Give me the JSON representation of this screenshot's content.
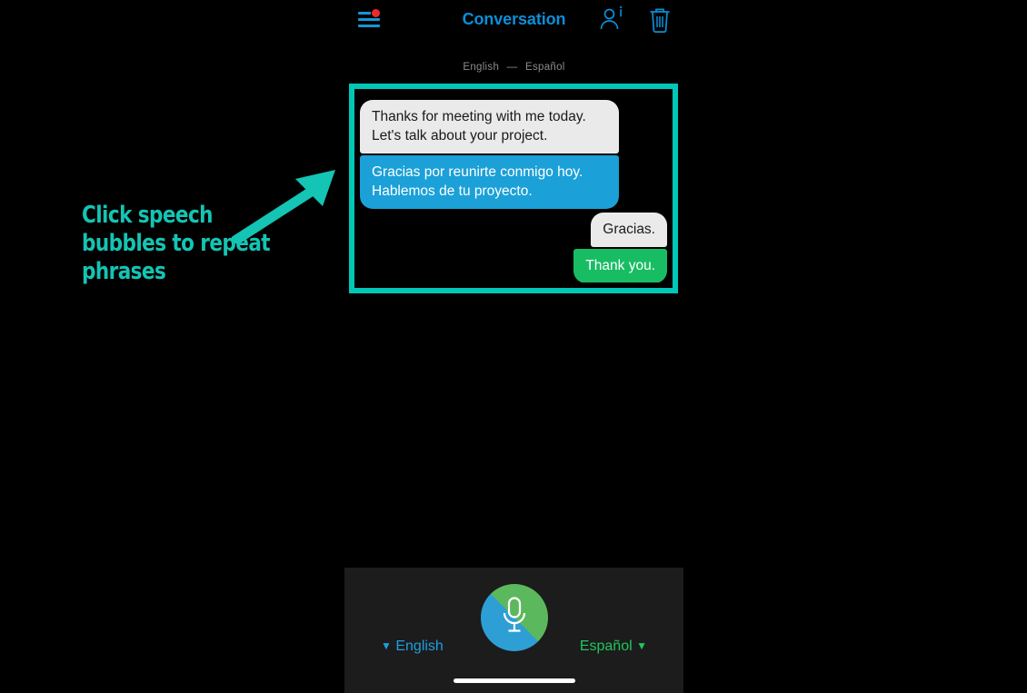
{
  "app": {
    "background_color": "#000000",
    "accent_blue": "#0a8fd8",
    "accent_green": "#18bd63",
    "highlight_teal": "#00c7b7"
  },
  "header": {
    "title": "Conversation",
    "menu_icon": "hamburger-menu-icon",
    "menu_badge": true,
    "person_info_icon": "person-info-icon",
    "trash_icon": "trash-icon"
  },
  "subtitle": {
    "source_language": "English",
    "separator": "—",
    "target_language": "Español"
  },
  "conversation": {
    "messages": [
      {
        "side": "left",
        "source_text": "Thanks for meeting with me today. Let's talk about your project.",
        "translated_text": "Gracias por reunirte conmigo hoy. Hablemos de tu proyecto.",
        "source_bubble_color": "#eaeaea",
        "translated_bubble_color": "#1ba0d8"
      },
      {
        "side": "right",
        "source_text": "Gracias.",
        "translated_text": "Thank you.",
        "source_bubble_color": "#eaeaea",
        "translated_bubble_color": "#18bd63"
      }
    ]
  },
  "bottom_bar": {
    "mic_icon": "microphone-icon",
    "left_language": {
      "caret": "▼",
      "label": "English",
      "color": "#1d9fe0"
    },
    "right_language": {
      "label": "Español",
      "caret": "▼",
      "color": "#22c55e"
    },
    "home_indicator": true
  },
  "annotation": {
    "line1": "Click speech",
    "line2": "bubbles to repeat",
    "line3": "phrases",
    "color": "#14c4b4",
    "arrow": "arrow-up-right"
  }
}
